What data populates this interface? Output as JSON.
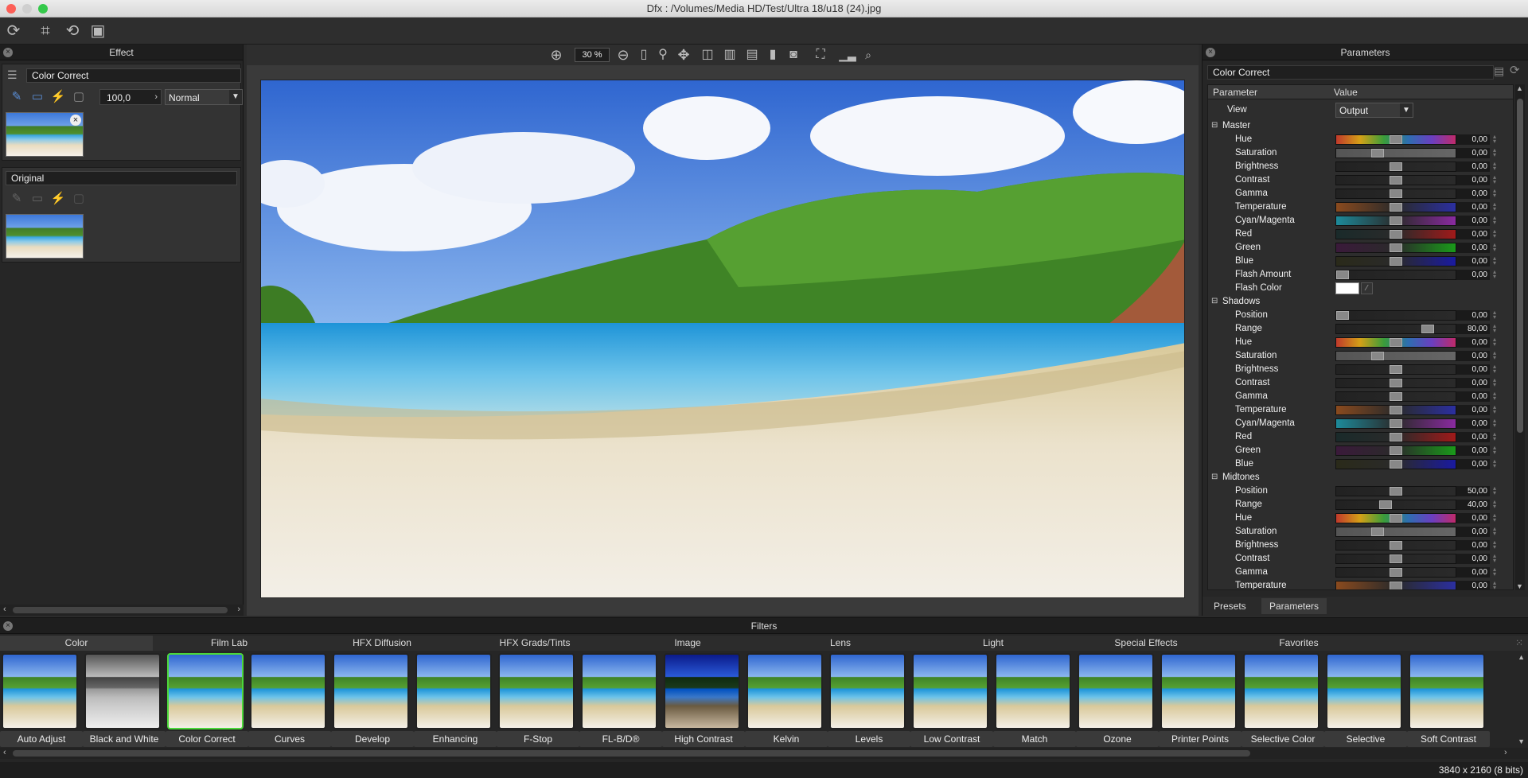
{
  "window": {
    "title": "Dfx : /Volumes/Media HD/Test/Ultra 18/u18 (24).jpg"
  },
  "effect_panel": {
    "title": "Effect",
    "effect_name": "Color Correct",
    "opacity": "100,0",
    "blend_mode": "Normal",
    "original_label": "Original"
  },
  "viewer": {
    "zoom": "30 %"
  },
  "params_panel": {
    "title": "Parameters",
    "effect_name": "Color Correct",
    "col_param": "Parameter",
    "col_value": "Value",
    "view_label": "View",
    "view_value": "Output",
    "tabs": [
      "Presets",
      "Parameters"
    ],
    "rows": [
      {
        "kind": "group",
        "label": "Master"
      },
      {
        "kind": "param",
        "label": "Hue",
        "value": "0,00",
        "grad": "hue",
        "pos": 0.5
      },
      {
        "kind": "param",
        "label": "Saturation",
        "value": "0,00",
        "grad": "sat",
        "pos": 0.33
      },
      {
        "kind": "param",
        "label": "Brightness",
        "value": "0,00",
        "grad": "gray",
        "pos": 0.5
      },
      {
        "kind": "param",
        "label": "Contrast",
        "value": "0,00",
        "grad": "gray",
        "pos": 0.5
      },
      {
        "kind": "param",
        "label": "Gamma",
        "value": "0,00",
        "grad": "gray",
        "pos": 0.5
      },
      {
        "kind": "param",
        "label": "Temperature",
        "value": "0,00",
        "grad": "temp",
        "pos": 0.5
      },
      {
        "kind": "param",
        "label": "Cyan/Magenta",
        "value": "0,00",
        "grad": "cm",
        "pos": 0.5
      },
      {
        "kind": "param",
        "label": "Red",
        "value": "0,00",
        "grad": "red",
        "pos": 0.5
      },
      {
        "kind": "param",
        "label": "Green",
        "value": "0,00",
        "grad": "green",
        "pos": 0.5
      },
      {
        "kind": "param",
        "label": "Blue",
        "value": "0,00",
        "grad": "blue",
        "pos": 0.5
      },
      {
        "kind": "param",
        "label": "Flash Amount",
        "value": "0,00",
        "grad": "gray",
        "pos": 0.0
      },
      {
        "kind": "color",
        "label": "Flash Color"
      },
      {
        "kind": "group",
        "label": "Shadows"
      },
      {
        "kind": "param",
        "label": "Position",
        "value": "0,00",
        "grad": "gray",
        "pos": 0.0
      },
      {
        "kind": "param",
        "label": "Range",
        "value": "80,00",
        "grad": "gray",
        "pos": 0.8
      },
      {
        "kind": "param",
        "label": "Hue",
        "value": "0,00",
        "grad": "hue",
        "pos": 0.5
      },
      {
        "kind": "param",
        "label": "Saturation",
        "value": "0,00",
        "grad": "sat",
        "pos": 0.33
      },
      {
        "kind": "param",
        "label": "Brightness",
        "value": "0,00",
        "grad": "gray",
        "pos": 0.5
      },
      {
        "kind": "param",
        "label": "Contrast",
        "value": "0,00",
        "grad": "gray",
        "pos": 0.5
      },
      {
        "kind": "param",
        "label": "Gamma",
        "value": "0,00",
        "grad": "gray",
        "pos": 0.5
      },
      {
        "kind": "param",
        "label": "Temperature",
        "value": "0,00",
        "grad": "temp",
        "pos": 0.5
      },
      {
        "kind": "param",
        "label": "Cyan/Magenta",
        "value": "0,00",
        "grad": "cm",
        "pos": 0.5
      },
      {
        "kind": "param",
        "label": "Red",
        "value": "0,00",
        "grad": "red",
        "pos": 0.5
      },
      {
        "kind": "param",
        "label": "Green",
        "value": "0,00",
        "grad": "green",
        "pos": 0.5
      },
      {
        "kind": "param",
        "label": "Blue",
        "value": "0,00",
        "grad": "blue",
        "pos": 0.5
      },
      {
        "kind": "group",
        "label": "Midtones"
      },
      {
        "kind": "param",
        "label": "Position",
        "value": "50,00",
        "grad": "gray",
        "pos": 0.5
      },
      {
        "kind": "param",
        "label": "Range",
        "value": "40,00",
        "grad": "gray",
        "pos": 0.4
      },
      {
        "kind": "param",
        "label": "Hue",
        "value": "0,00",
        "grad": "hue",
        "pos": 0.5
      },
      {
        "kind": "param",
        "label": "Saturation",
        "value": "0,00",
        "grad": "sat",
        "pos": 0.33
      },
      {
        "kind": "param",
        "label": "Brightness",
        "value": "0,00",
        "grad": "gray",
        "pos": 0.5
      },
      {
        "kind": "param",
        "label": "Contrast",
        "value": "0,00",
        "grad": "gray",
        "pos": 0.5
      },
      {
        "kind": "param",
        "label": "Gamma",
        "value": "0,00",
        "grad": "gray",
        "pos": 0.5
      },
      {
        "kind": "param",
        "label": "Temperature",
        "value": "0,00",
        "grad": "temp",
        "pos": 0.5
      }
    ]
  },
  "filters": {
    "title": "Filters",
    "tabs": [
      "Color",
      "Film Lab",
      "HFX Diffusion",
      "HFX Grads/Tints",
      "Image",
      "Lens",
      "Light",
      "Special Effects",
      "Favorites"
    ],
    "active_tab": "Color",
    "items": [
      "Auto Adjust",
      "Black and White",
      "Color Correct",
      "Curves",
      "Develop",
      "Enhancing",
      "F-Stop",
      "FL-B/D®",
      "High Contrast",
      "Kelvin",
      "Levels",
      "Low Contrast",
      "Match",
      "Ozone",
      "Printer Points",
      "Selective Color",
      "Selective",
      "Soft Contrast"
    ],
    "selected": "Color Correct"
  },
  "status": {
    "image_info": "3840 x 2160 (8 bits)"
  },
  "colors": {
    "selected_filter": "#4cd83a",
    "accent_icon": "#5b8fd8"
  }
}
